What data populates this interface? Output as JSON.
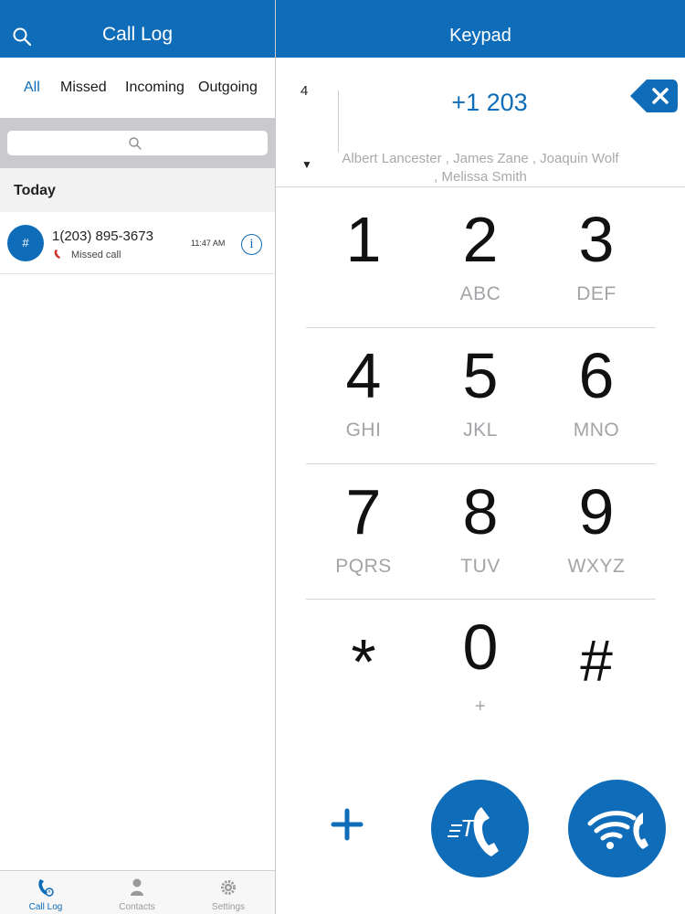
{
  "colors": {
    "brand": "#0e6cb8",
    "missed": "#d0312d",
    "muted": "#a4a4a8"
  },
  "call_log": {
    "title": "Call Log",
    "filters": [
      "All",
      "Missed",
      "Incoming",
      "Outgoing"
    ],
    "active_filter": "All",
    "search": {
      "placeholder": ""
    },
    "section": "Today",
    "calls": [
      {
        "avatar": "#",
        "number": "1(203) 895-3673",
        "status": "Missed call",
        "time": "11:47 AM",
        "status_icon": "missed-call-icon"
      }
    ],
    "tabs": [
      {
        "label": "Call Log",
        "icon": "call-log-icon",
        "active": true
      },
      {
        "label": "Contacts",
        "icon": "person-icon",
        "active": false
      },
      {
        "label": "Settings",
        "icon": "gear-icon",
        "active": false
      }
    ]
  },
  "keypad": {
    "title": "Keypad",
    "match_count": "4",
    "match_toggle": "▼",
    "dialed": "+1 203",
    "suggestions": "Albert Lancester , James Zane , Joaquin Wolf , Melissa Smith",
    "keys": [
      {
        "digit": "1",
        "letters": ""
      },
      {
        "digit": "2",
        "letters": "ABC"
      },
      {
        "digit": "3",
        "letters": "DEF"
      },
      {
        "digit": "4",
        "letters": "GHI"
      },
      {
        "digit": "5",
        "letters": "JKL"
      },
      {
        "digit": "6",
        "letters": "MNO"
      },
      {
        "digit": "7",
        "letters": "PQRS"
      },
      {
        "digit": "8",
        "letters": "TUV"
      },
      {
        "digit": "9",
        "letters": "WXYZ"
      },
      {
        "digit": "*",
        "letters": ""
      },
      {
        "digit": "0",
        "letters": "+"
      },
      {
        "digit": "#",
        "letters": ""
      }
    ],
    "actions": {
      "add": "plus-icon",
      "call": "call-transfer-icon",
      "transfer": "wifi-call-icon"
    }
  }
}
